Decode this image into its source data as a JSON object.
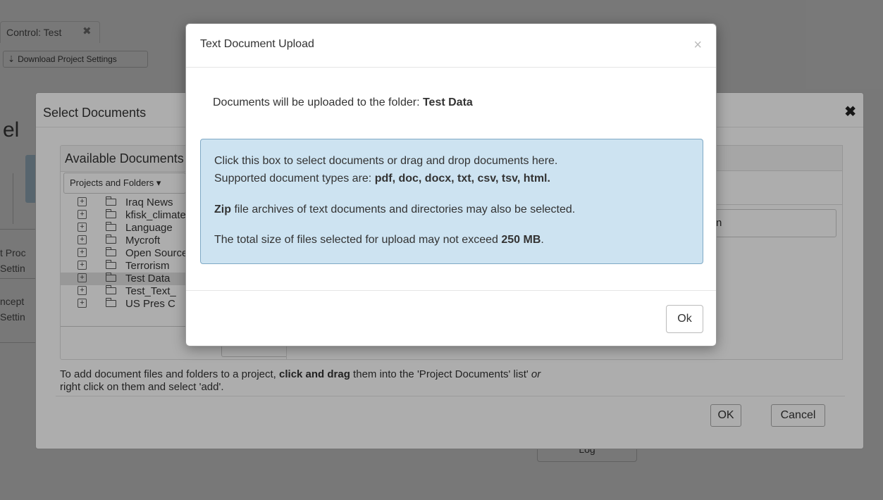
{
  "background": {
    "tab_label": "Control: Test",
    "tab_close": "✖",
    "download_button": "Download Project Settings",
    "heading": "el",
    "side_label_1": [
      "t Proc",
      "Settin"
    ],
    "side_label_2": [
      "ncept",
      "Settin"
    ],
    "log_button": "Log"
  },
  "select_documents": {
    "title": "Select Documents",
    "close": "✖",
    "available_title": "Available Documents",
    "projects_folders_button": "Projects and Folders ▾",
    "tree": [
      {
        "label": "Iraq News",
        "selected": false
      },
      {
        "label": "kfisk_climate",
        "selected": false
      },
      {
        "label": "Language",
        "selected": false
      },
      {
        "label": "Mycroft",
        "selected": false
      },
      {
        "label": "Open Source",
        "selected": false
      },
      {
        "label": "Terrorism",
        "selected": false
      },
      {
        "label": "Test Data",
        "selected": true
      },
      {
        "label": "Test_Text_",
        "selected": false
      },
      {
        "label": "US Pres C",
        "selected": false
      }
    ],
    "project_input_value": "n",
    "help_prefix": "To add document files and folders to a project, ",
    "help_bold": "click and drag",
    "help_middle": " them into the 'Project Documents' list' ",
    "help_italic": "or",
    "help_line2": "right click on them and select 'add'.",
    "ok_button": "OK",
    "cancel_button": "Cancel"
  },
  "upload_dialog": {
    "title": "Text Document Upload",
    "close": "×",
    "dest_prefix": "Documents will be uploaded to the folder: ",
    "dest_folder": "Test Data",
    "dz_line1": "Click this box to select documents or drag and drop documents here.",
    "dz_line2_prefix": "Supported document types are: ",
    "dz_types": "pdf, doc, docx, txt, csv, tsv, html.",
    "dz_zip_bold": "Zip",
    "dz_zip_rest": " file archives of text documents and directories may also be selected.",
    "dz_size_prefix": "The total size of files selected for upload may not exceed ",
    "dz_size_value": "250 MB",
    "dz_size_suffix": ".",
    "ok_button": "Ok"
  }
}
